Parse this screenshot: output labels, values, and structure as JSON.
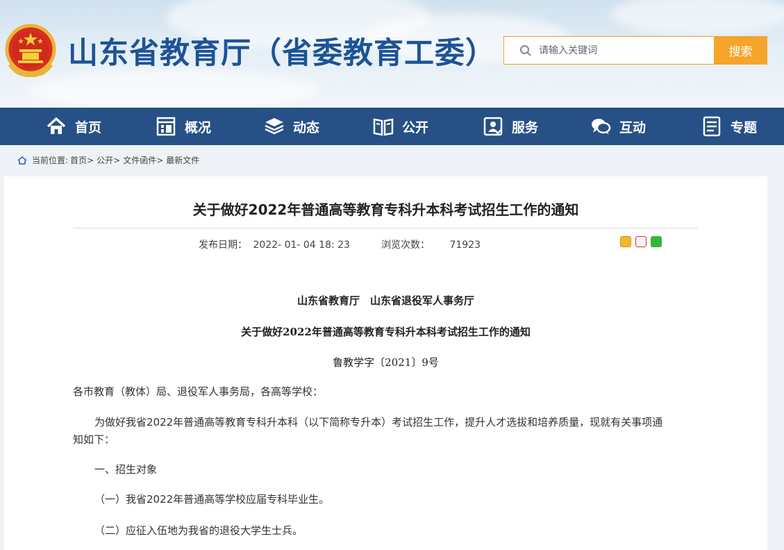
{
  "header": {
    "site_title": "山东省教育厅（省委教育工委）",
    "search_placeholder": "请输入关键词",
    "search_button": "搜索"
  },
  "nav": {
    "items": [
      {
        "label": "首页",
        "icon": "home-icon"
      },
      {
        "label": "概况",
        "icon": "building-icon"
      },
      {
        "label": "动态",
        "icon": "layers-icon"
      },
      {
        "label": "公开",
        "icon": "book-icon"
      },
      {
        "label": "服务",
        "icon": "service-icon"
      },
      {
        "label": "互动",
        "icon": "chat-icon"
      },
      {
        "label": "专题",
        "icon": "document-icon"
      }
    ]
  },
  "breadcrumb": {
    "prefix": "当前位置:",
    "items": [
      "首页",
      "公开",
      "文件函件",
      "最新文件"
    ],
    "separator": ">"
  },
  "article": {
    "title": "关于做好2022年普通高等教育专科升本科考试招生工作的通知",
    "publish_label": "发布日期：",
    "publish_date": "2022- 01- 04 18: 23",
    "views_label": "浏览次数：",
    "views_count": "71923",
    "issuers": "山东省教育厅　山东省退役军人事务厅",
    "doc_title": "关于做好2022年普通高等教育专科升本科考试招生工作的通知",
    "doc_number": "鲁教学字〔2021〕9号",
    "recipients": "各市教育（教体）局、退役军人事务局，各高等学校：",
    "intro_line1": "为做好我省2022年普通高等教育专科升本科（以下简称专升本）考试招生工作，提升人才选拔和培养质量，现就有关事项通",
    "intro_line2": "知如下：",
    "section1": "一、招生对象",
    "item1": "（一）我省2022年普通高等学校应届专科毕业生。",
    "item2": "（二）应征入伍地为我省的退役大学生士兵。"
  },
  "colors": {
    "nav_bg": "#265086",
    "title_blue": "#1d5396",
    "search_accent": "#f5a42c"
  }
}
